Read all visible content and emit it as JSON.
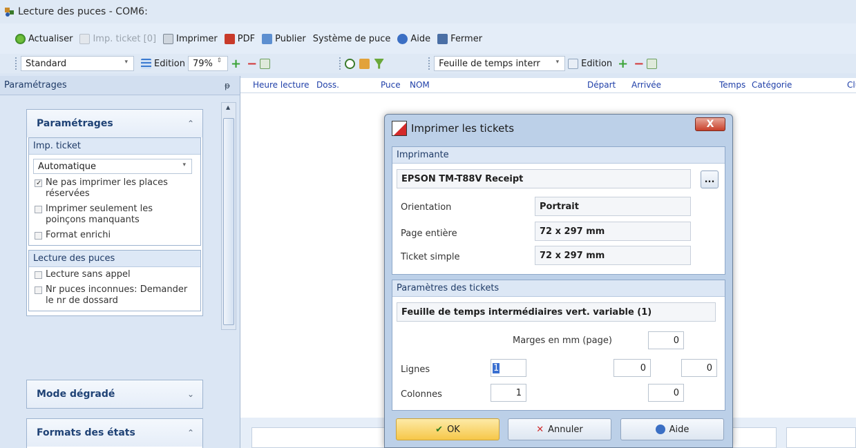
{
  "window": {
    "title": "Lecture des puces - COM6:"
  },
  "toolbar1": {
    "refresh": "Actualiser",
    "imp_ticket": "Imp. ticket [0]",
    "print": "Imprimer",
    "pdf": "PDF",
    "publish": "Publier",
    "chip_system": "Système de puce",
    "help": "Aide",
    "close": "Fermer"
  },
  "toolbar2": {
    "layout_combo": "Standard",
    "edition1": "Edition",
    "zoom": "79%",
    "sheet_combo": "Feuille de temps interr",
    "edition2": "Edition"
  },
  "left": {
    "panel_title": "Paramétrages",
    "pin": "ᵽ",
    "group1_title": "Paramétrages",
    "imp_ticket_title": "Imp. ticket",
    "imp_ticket_mode": "Automatique",
    "opt_no_print_reserved": "Ne pas imprimer les places réservées",
    "opt_print_missing": "Imprimer seulement les poinçons manquants",
    "opt_rich_format": "Format enrichi",
    "reading_title": "Lecture des puces",
    "opt_no_call": "Lecture sans appel",
    "opt_unknown": "Nr puces inconnues: Demander le nr de dossard",
    "group2_title": "Mode dégradé",
    "group3_title": "Formats des états"
  },
  "grid": {
    "headers": [
      "Heure lecture",
      "Doss.",
      "Puce",
      "NOM",
      "Départ",
      "Arrivée",
      "Temps",
      "Catégorie",
      "Club"
    ]
  },
  "dialog": {
    "title": "Imprimer les tickets",
    "close": "X",
    "printer_section": "Imprimante",
    "printer_name": "EPSON TM-T88V Receipt",
    "browse": "...",
    "orientation_label": "Orientation",
    "orientation_value": "Portrait",
    "full_page_label": "Page entière",
    "full_page_value": "72 x 297 mm",
    "simple_ticket_label": "Ticket simple",
    "simple_ticket_value": "72 x 297 mm",
    "ticket_section": "Paramètres des tickets",
    "ticket_format": "Feuille de temps intermédiaires vert. variable (1)",
    "margins_label": "Marges en mm (page)",
    "margin_top": "0",
    "rows_label": "Lignes",
    "rows_value": "1",
    "margin_mid": "0",
    "margin_right": "0",
    "cols_label": "Colonnes",
    "cols_value": "1",
    "margin_bottom": "0",
    "ok": "OK",
    "cancel": "Annuler",
    "help": "Aide"
  }
}
